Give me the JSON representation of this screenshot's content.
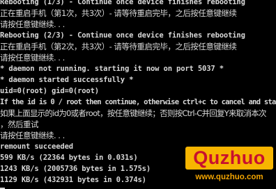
{
  "terminal": {
    "lines": [
      "Rebooting (1/3) - Continue once device finishes rebooting",
      "正在重启手机（第1次，共3次）- 请等待重启完毕，之后按任意键继续",
      "请按任意键继续. . .",
      "Rebooting (2/3) - Continue once device finishes rebooting",
      "正在重启手机（第2次，共3次）- 请等待重启完毕，之后按任意键继续",
      "请按任意键继续. . .",
      "* daemon not running. starting it now on port 5037 *",
      "* daemon started successfully *",
      "uid=0(root) gid=0(root)",
      "If the id is 0 / root then continue, otherwise ctrl+c to cancel and sta",
      "如果上面显示的id为0或者root，按任意键继续；否则按Ctrl-C并回复Y来取消本次",
      "，然后重试",
      "请按任意键继续. . .",
      "remount succeeded",
      "599 KB/s (22364 bytes in 0.031s)",
      "1243 KB/s (2005736 bytes in 1.575s)",
      "1129 KB/s (432931 bytes in 0.374s)"
    ]
  },
  "watermark": {
    "logo_text": "Quzhuo",
    "url_text": "www.quzhuo.com",
    "logo_bg_color": "#f7b500",
    "logo_text_color": "#c8102e",
    "url_color": "#f2a400"
  },
  "colors": {
    "background": "#000000",
    "foreground": "#d8d8d8"
  }
}
